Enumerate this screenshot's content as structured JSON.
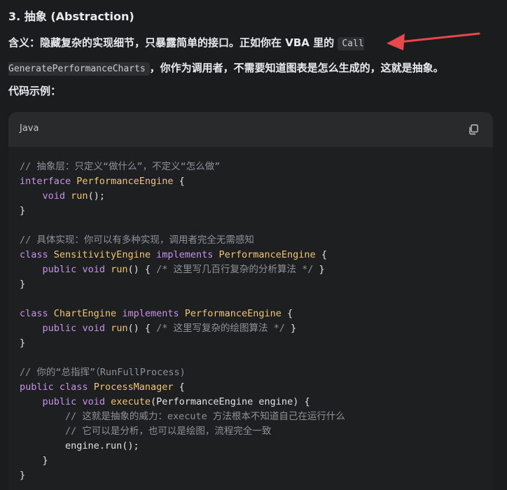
{
  "section": {
    "heading": "3. 抽象 (Abstraction)",
    "definition_label": "含义：",
    "definition_text_1": "隐藏复杂的实现细节，只暴露简单的接口。正如你在 VBA 里的 ",
    "inline_code": "Call GeneratePerformanceCharts",
    "definition_text_2": "，你作为调用者，不需要知道图表是怎么生成的，这就是抽象。",
    "examples_heading": "代码示例："
  },
  "code_block": {
    "language": "Java",
    "copy_icon": "copy-icon",
    "lines": [
      [
        {
          "c": "t-comment",
          "t": "// 抽象层：只定义“做什么”，不定义“怎么做”"
        }
      ],
      [
        {
          "c": "t-kw",
          "t": "interface"
        },
        {
          "c": "t-plain",
          "t": " "
        },
        {
          "c": "t-type",
          "t": "PerformanceEngine"
        },
        {
          "c": "t-plain",
          "t": " {"
        }
      ],
      [
        {
          "c": "t-plain",
          "t": "    "
        },
        {
          "c": "t-kw",
          "t": "void"
        },
        {
          "c": "t-plain",
          "t": " "
        },
        {
          "c": "t-fn",
          "t": "run"
        },
        {
          "c": "t-plain",
          "t": "();"
        }
      ],
      [
        {
          "c": "t-plain",
          "t": "}"
        }
      ],
      [
        {
          "c": "t-plain",
          "t": ""
        }
      ],
      [
        {
          "c": "t-comment",
          "t": "// 具体实现：你可以有多种实现，调用者完全无需感知"
        }
      ],
      [
        {
          "c": "t-kw",
          "t": "class"
        },
        {
          "c": "t-plain",
          "t": " "
        },
        {
          "c": "t-type",
          "t": "SensitivityEngine"
        },
        {
          "c": "t-plain",
          "t": " "
        },
        {
          "c": "t-kw",
          "t": "implements"
        },
        {
          "c": "t-plain",
          "t": " "
        },
        {
          "c": "t-type",
          "t": "PerformanceEngine"
        },
        {
          "c": "t-plain",
          "t": " {"
        }
      ],
      [
        {
          "c": "t-plain",
          "t": "    "
        },
        {
          "c": "t-kw",
          "t": "public"
        },
        {
          "c": "t-plain",
          "t": " "
        },
        {
          "c": "t-kw",
          "t": "void"
        },
        {
          "c": "t-plain",
          "t": " "
        },
        {
          "c": "t-fn",
          "t": "run"
        },
        {
          "c": "t-plain",
          "t": "() { "
        },
        {
          "c": "t-comment",
          "t": "/* 这里写几百行复杂的分析算法 */"
        },
        {
          "c": "t-plain",
          "t": " }"
        }
      ],
      [
        {
          "c": "t-plain",
          "t": "}"
        }
      ],
      [
        {
          "c": "t-plain",
          "t": ""
        }
      ],
      [
        {
          "c": "t-kw",
          "t": "class"
        },
        {
          "c": "t-plain",
          "t": " "
        },
        {
          "c": "t-type",
          "t": "ChartEngine"
        },
        {
          "c": "t-plain",
          "t": " "
        },
        {
          "c": "t-kw",
          "t": "implements"
        },
        {
          "c": "t-plain",
          "t": " "
        },
        {
          "c": "t-type",
          "t": "PerformanceEngine"
        },
        {
          "c": "t-plain",
          "t": " {"
        }
      ],
      [
        {
          "c": "t-plain",
          "t": "    "
        },
        {
          "c": "t-kw",
          "t": "public"
        },
        {
          "c": "t-plain",
          "t": " "
        },
        {
          "c": "t-kw",
          "t": "void"
        },
        {
          "c": "t-plain",
          "t": " "
        },
        {
          "c": "t-fn",
          "t": "run"
        },
        {
          "c": "t-plain",
          "t": "() { "
        },
        {
          "c": "t-comment",
          "t": "/* 这里写复杂的绘图算法 */"
        },
        {
          "c": "t-plain",
          "t": " }"
        }
      ],
      [
        {
          "c": "t-plain",
          "t": "}"
        }
      ],
      [
        {
          "c": "t-plain",
          "t": ""
        }
      ],
      [
        {
          "c": "t-comment",
          "t": "// 你的“总指挥”（RunFullProcess)"
        }
      ],
      [
        {
          "c": "t-kw",
          "t": "public"
        },
        {
          "c": "t-plain",
          "t": " "
        },
        {
          "c": "t-kw",
          "t": "class"
        },
        {
          "c": "t-plain",
          "t": " "
        },
        {
          "c": "t-type",
          "t": "ProcessManager"
        },
        {
          "c": "t-plain",
          "t": " {"
        }
      ],
      [
        {
          "c": "t-plain",
          "t": "    "
        },
        {
          "c": "t-kw",
          "t": "public"
        },
        {
          "c": "t-plain",
          "t": " "
        },
        {
          "c": "t-kw",
          "t": "void"
        },
        {
          "c": "t-plain",
          "t": " "
        },
        {
          "c": "t-fn",
          "t": "execute"
        },
        {
          "c": "t-plain",
          "t": "(PerformanceEngine engine) {"
        }
      ],
      [
        {
          "c": "t-plain",
          "t": "        "
        },
        {
          "c": "t-comment",
          "t": "// 这就是抽象的威力：execute 方法根本不知道自己在运行什么"
        }
      ],
      [
        {
          "c": "t-plain",
          "t": "        "
        },
        {
          "c": "t-comment",
          "t": "// 它可以是分析，也可以是绘图，流程完全一致"
        }
      ],
      [
        {
          "c": "t-plain",
          "t": "        engine.run();"
        }
      ],
      [
        {
          "c": "t-plain",
          "t": "    }"
        }
      ],
      [
        {
          "c": "t-plain",
          "t": "}"
        }
      ]
    ]
  },
  "colors": {
    "background": "#1b1c1d",
    "code_background": "#1e1f20",
    "keyword": "#c792ea",
    "type": "#f0c674",
    "comment": "#8e9196",
    "arrow": "#e8474b"
  }
}
